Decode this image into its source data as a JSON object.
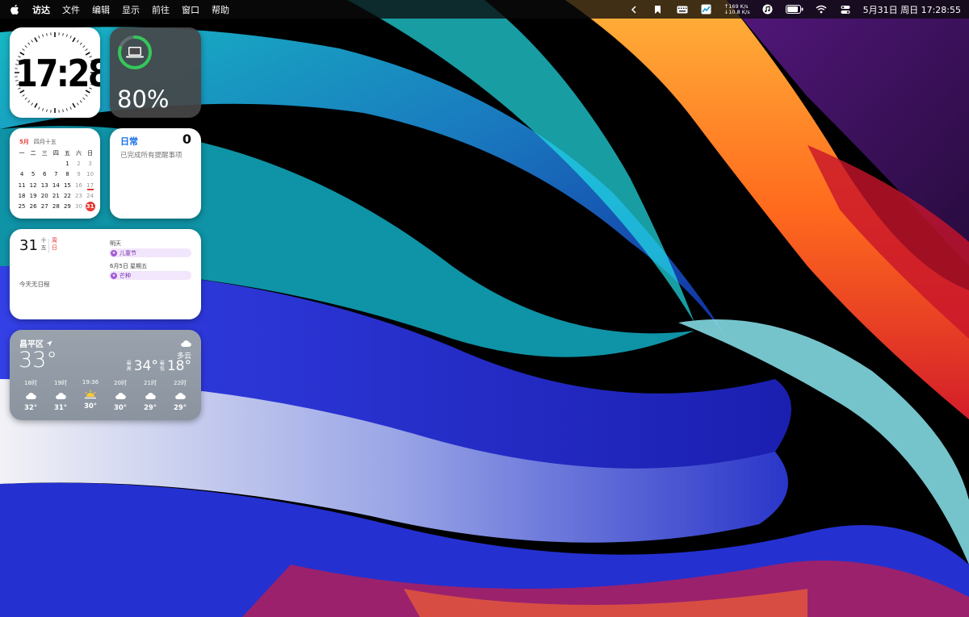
{
  "menubar": {
    "apple_icon": "apple-logo-icon",
    "app_name": "访达",
    "menus": [
      "文件",
      "编辑",
      "显示",
      "前往",
      "窗口",
      "帮助"
    ],
    "net_up": "↑169 K/s",
    "net_down": "↓10.8 K/s",
    "datetime": "5月31日 周日  17:28:55"
  },
  "clock_widget": {
    "time": "17:28"
  },
  "battery_widget": {
    "percent_text": "80%",
    "level": 0.8,
    "ring_color": "#34c759"
  },
  "month_widget": {
    "month": "5月",
    "lunar": "四月十五",
    "weekdays": [
      "一",
      "二",
      "三",
      "四",
      "五",
      "六",
      "日"
    ],
    "weeks": [
      [
        "",
        "",
        "",
        "",
        "1",
        "2",
        "3"
      ],
      [
        "4",
        "5",
        "6",
        "7",
        "8",
        "9",
        "10"
      ],
      [
        "11",
        "12",
        "13",
        "14",
        "15",
        "16",
        "17"
      ],
      [
        "18",
        "19",
        "20",
        "21",
        "22",
        "23",
        "24"
      ],
      [
        "25",
        "26",
        "27",
        "28",
        "29",
        "30",
        "31"
      ]
    ],
    "today": "31",
    "marked": "17",
    "accent": "#e53935"
  },
  "reminders_widget": {
    "title": "日常",
    "count": "0",
    "subtitle": "已完成所有提醒事项"
  },
  "day_widget": {
    "day": "31",
    "lunar_chars": [
      "十",
      "五"
    ],
    "weekday_chars": [
      "周",
      "日"
    ],
    "no_events": "今天无日程",
    "groups": [
      {
        "label": "明天",
        "event": "儿童节"
      },
      {
        "label": "6月5日 星期五",
        "event": "芒种"
      }
    ]
  },
  "weather_widget": {
    "location": "昌平区",
    "temp": "33°",
    "condition": "多云",
    "high_label": "最高",
    "high": "34°",
    "low_label": "最低",
    "low": "18°",
    "hours": [
      {
        "time": "18时",
        "icon": "cloud-icon",
        "temp": "32°"
      },
      {
        "time": "19时",
        "icon": "cloud-icon",
        "temp": "31°"
      },
      {
        "time": "19:36",
        "icon": "sunset-icon",
        "temp": "30°"
      },
      {
        "time": "20时",
        "icon": "cloud-icon",
        "temp": "30°"
      },
      {
        "time": "21时",
        "icon": "cloud-icon",
        "temp": "29°"
      },
      {
        "time": "22时",
        "icon": "cloud-icon",
        "temp": "29°"
      }
    ]
  }
}
